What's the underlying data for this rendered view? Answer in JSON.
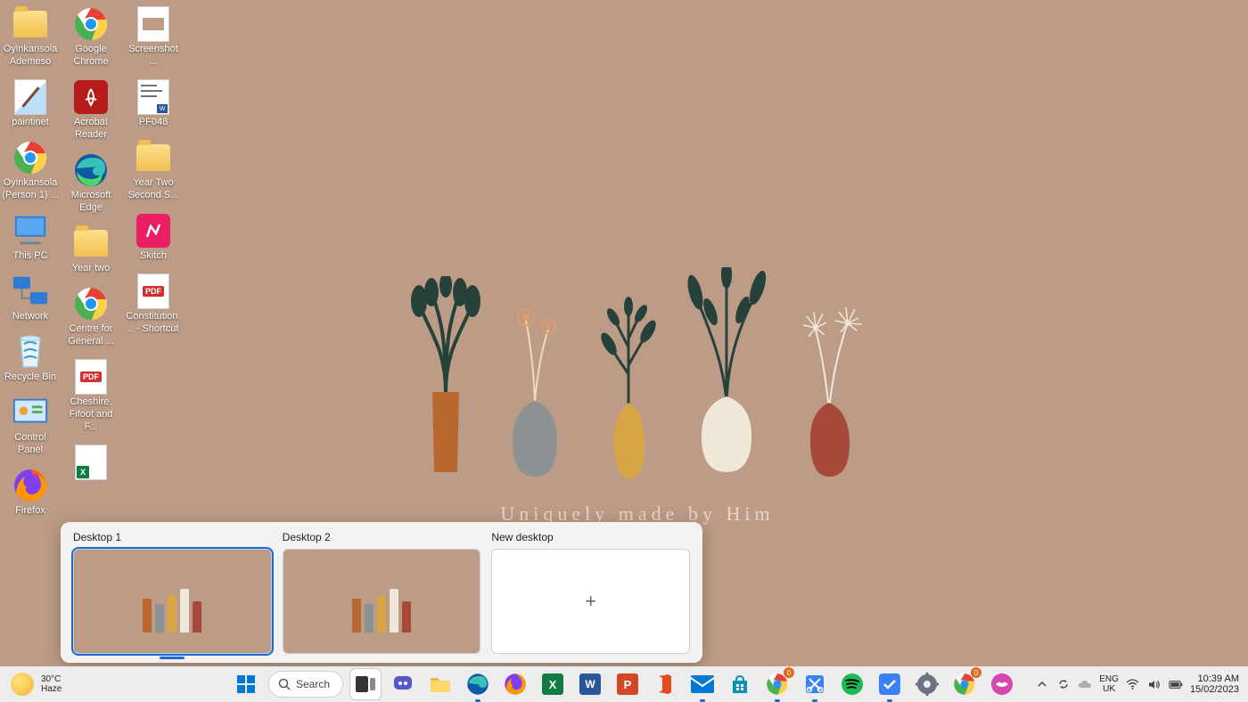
{
  "wallpaper_caption": "Uniquely made by Him",
  "desktop_icons": {
    "col1": [
      {
        "label": "Oyinkansola Ademeso",
        "kind": "folder"
      },
      {
        "label": "paintinet",
        "kind": "app-paint"
      },
      {
        "label": "Oyinkansola (Person 1) ...",
        "kind": "app-chrome"
      },
      {
        "label": "This PC",
        "kind": "sys-pc"
      },
      {
        "label": "Network",
        "kind": "sys-net"
      },
      {
        "label": "Recycle Bin",
        "kind": "sys-bin"
      },
      {
        "label": "Control Panel",
        "kind": "sys-cp"
      },
      {
        "label": "Firefox",
        "kind": "app-firefox"
      }
    ],
    "col2": [
      {
        "label": "Google Chrome",
        "kind": "app-chrome"
      },
      {
        "label": "Acrobat Reader",
        "kind": "app-acrobat"
      },
      {
        "label": "Microsoft Edge",
        "kind": "app-edge"
      },
      {
        "label": "Year two",
        "kind": "folder"
      },
      {
        "label": "Centre for General ...",
        "kind": "app-chrome"
      },
      {
        "label": "Cheshire, Fifoot and F...",
        "kind": "pdf"
      },
      {
        "label": "",
        "kind": "app-excel"
      }
    ],
    "col3": [
      {
        "label": "Screenshot ...",
        "kind": "doc-img"
      },
      {
        "label": "PF048",
        "kind": "doc-word"
      },
      {
        "label": "Year Two Second S...",
        "kind": "folder"
      },
      {
        "label": "Skitch",
        "kind": "app-skitch"
      },
      {
        "label": "Constitution... - Shortcut",
        "kind": "pdf"
      }
    ]
  },
  "taskview": {
    "items": [
      {
        "label": "Desktop 1",
        "active": true
      },
      {
        "label": "Desktop 2",
        "active": false
      }
    ],
    "new_label": "New desktop"
  },
  "taskbar": {
    "weather": {
      "temp": "30°C",
      "cond": "Haze"
    },
    "search_placeholder": "Search",
    "apps": [
      {
        "name": "start",
        "icon": "win"
      },
      {
        "name": "search",
        "icon": "search"
      },
      {
        "name": "task-view",
        "icon": "taskview",
        "active": true
      },
      {
        "name": "chat",
        "icon": "chat"
      },
      {
        "name": "file-explorer",
        "icon": "folder"
      },
      {
        "name": "edge",
        "icon": "edge",
        "running": true
      },
      {
        "name": "firefox",
        "icon": "firefox"
      },
      {
        "name": "excel",
        "icon": "excel"
      },
      {
        "name": "word",
        "icon": "word"
      },
      {
        "name": "powerpoint",
        "icon": "ppt"
      },
      {
        "name": "office",
        "icon": "office"
      },
      {
        "name": "mail",
        "icon": "mail",
        "running": true
      },
      {
        "name": "store",
        "icon": "store"
      },
      {
        "name": "chrome",
        "icon": "chrome",
        "badge": "0",
        "running": true
      },
      {
        "name": "snip",
        "icon": "snip",
        "running": true
      },
      {
        "name": "spotify",
        "icon": "spotify"
      },
      {
        "name": "todo",
        "icon": "todo",
        "running": true
      },
      {
        "name": "settings",
        "icon": "gear"
      },
      {
        "name": "chrome-2",
        "icon": "chrome",
        "badge": "0"
      },
      {
        "name": "lips",
        "icon": "lips"
      }
    ],
    "tray": {
      "lang1": "ENG",
      "lang2": "UK",
      "time": "10:39 AM",
      "date": "15/02/2023"
    }
  }
}
